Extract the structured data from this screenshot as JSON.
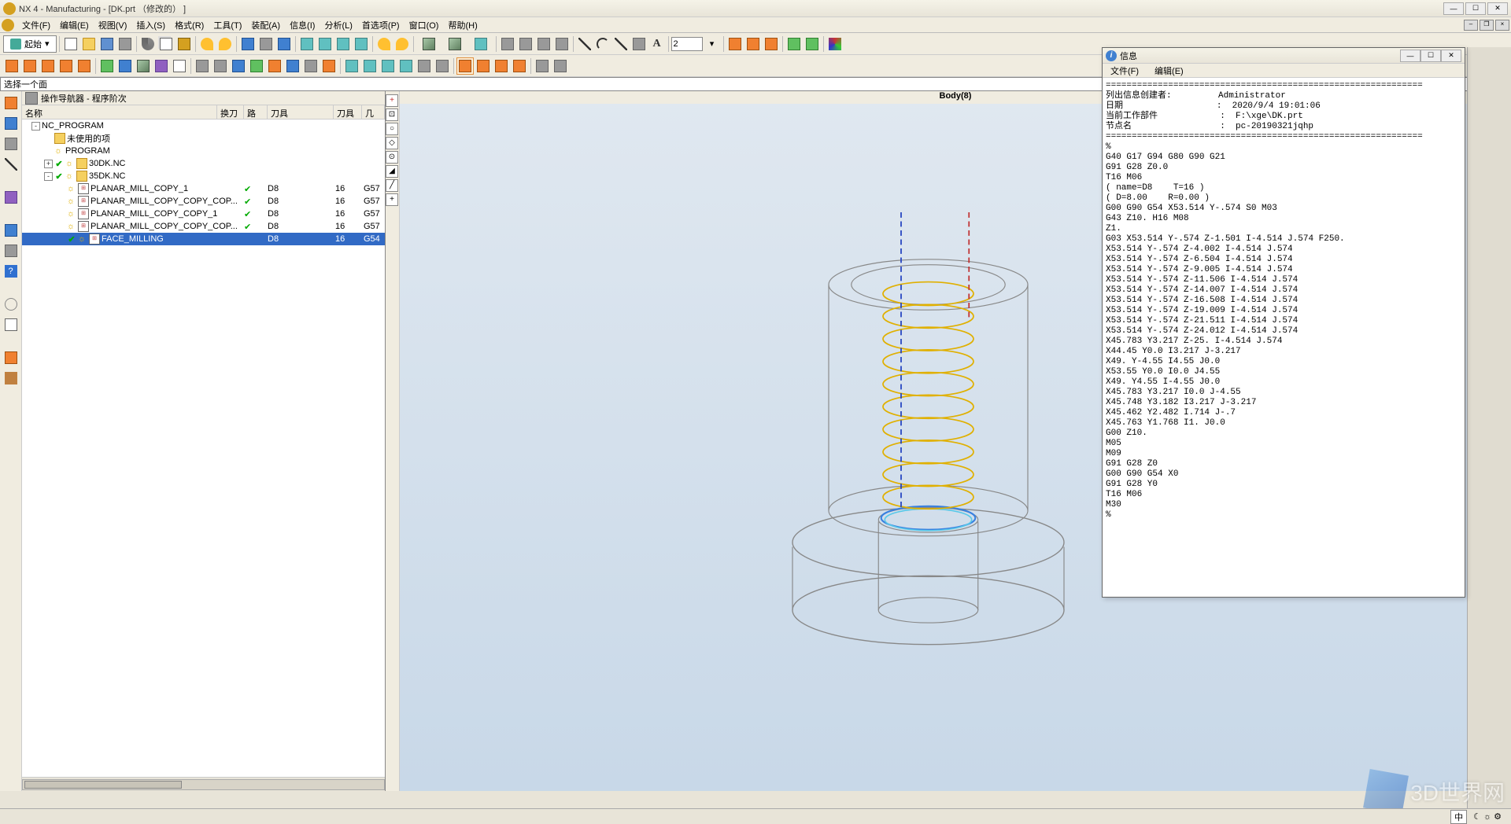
{
  "window": {
    "title": "NX 4 - Manufacturing - [DK.prt （修改的） ]",
    "tab_title": "NX 4 - Manufacturing - [DK.prt ..."
  },
  "menu": {
    "file": "文件(F)",
    "edit": "编辑(E)",
    "view": "视图(V)",
    "insert": "插入(S)",
    "format": "格式(R)",
    "tools": "工具(T)",
    "assembly": "装配(A)",
    "info": "信息(I)",
    "analysis": "分析(L)",
    "preferences": "首选项(P)",
    "window": "窗口(O)",
    "help": "帮助(H)"
  },
  "toolbar": {
    "start_label": "起始",
    "num_input": "2"
  },
  "selection_bar": "选择一个面",
  "viewport_title": "Body(8)",
  "navigator": {
    "title": "操作导航器 - 程序阶次",
    "cols": {
      "name": "名称",
      "tc": "换刀",
      "path": "路径",
      "tool": "刀具",
      "tnum": "刀具号",
      "geom": "几何体"
    },
    "rows": [
      {
        "indent": 0,
        "expand": "-",
        "label": "NC_PROGRAM"
      },
      {
        "indent": 1,
        "label": "未使用的项",
        "folder": true
      },
      {
        "indent": 1,
        "bulb": true,
        "label": "PROGRAM"
      },
      {
        "indent": 1,
        "expand": "+",
        "check": true,
        "bulb": true,
        "folder": true,
        "label": "30DK.NC"
      },
      {
        "indent": 1,
        "expand": "-",
        "check": true,
        "bulb": true,
        "folder": true,
        "label": "35DK.NC"
      },
      {
        "indent": 2,
        "bulb": true,
        "mill": true,
        "label": "PLANAR_MILL_COPY_1",
        "tc_ok": true,
        "tool": "D8",
        "tnum": "16",
        "geom": "G57"
      },
      {
        "indent": 2,
        "bulb": true,
        "mill": true,
        "label": "PLANAR_MILL_COPY_COPY_COP...",
        "tc_ok": true,
        "tool": "D8",
        "tnum": "16",
        "geom": "G57"
      },
      {
        "indent": 2,
        "bulb": true,
        "mill": true,
        "label": "PLANAR_MILL_COPY_COPY_1",
        "tc_ok": true,
        "tool": "D8",
        "tnum": "16",
        "geom": "G57"
      },
      {
        "indent": 2,
        "bulb": true,
        "mill": true,
        "label": "PLANAR_MILL_COPY_COPY_COP...",
        "tc_ok": true,
        "tool": "D8",
        "tnum": "16",
        "geom": "G57"
      },
      {
        "indent": 2,
        "check": true,
        "bulb": true,
        "mill": true,
        "label": "FACE_MILLING",
        "tc_ok": false,
        "tool": "D8",
        "tnum": "16",
        "geom": "G54",
        "selected": true
      }
    ]
  },
  "info_window": {
    "title": "信息",
    "menu_file": "文件(F)",
    "menu_edit": "编辑(E)",
    "body": "=============================================================\n列出信息创建者:         Administrator\n日期                  :  2020/9/4 19:01:06\n当前工作部件            :  F:\\xge\\DK.prt\n节点名                 :  pc-20190321jqhp\n=============================================================\n%\nG40 G17 G94 G80 G90 G21\nG91 G28 Z0.0\nT16 M06\n( name=D8    T=16 )\n( D=8.00    R=0.00 )\nG00 G90 G54 X53.514 Y-.574 S0 M03\nG43 Z10. H16 M08\nZ1.\nG03 X53.514 Y-.574 Z-1.501 I-4.514 J.574 F250.\nX53.514 Y-.574 Z-4.002 I-4.514 J.574\nX53.514 Y-.574 Z-6.504 I-4.514 J.574\nX53.514 Y-.574 Z-9.005 I-4.514 J.574\nX53.514 Y-.574 Z-11.506 I-4.514 J.574\nX53.514 Y-.574 Z-14.007 I-4.514 J.574\nX53.514 Y-.574 Z-16.508 I-4.514 J.574\nX53.514 Y-.574 Z-19.009 I-4.514 J.574\nX53.514 Y-.574 Z-21.511 I-4.514 J.574\nX53.514 Y-.574 Z-24.012 I-4.514 J.574\nX45.783 Y3.217 Z-25. I-4.514 J.574\nX44.45 Y0.0 I3.217 J-3.217\nX49. Y-4.55 I4.55 J0.0\nX53.55 Y0.0 I0.0 J4.55\nX49. Y4.55 I-4.55 J0.0\nX45.783 Y3.217 I0.0 J-4.55\nX45.748 Y3.182 I3.217 J-3.217\nX45.462 Y2.482 I.714 J-.7\nX45.763 Y1.768 I1. J0.0\nG00 Z10.\nM05\nM09\nG91 G28 Z0\nG00 G90 G54 X0\nG91 G28 Y0\nT16 M06\nM30\n%"
  },
  "watermark_text": "3D世界网",
  "status": {
    "ime": "中",
    "icons": "☾ ☼ ⚙"
  }
}
